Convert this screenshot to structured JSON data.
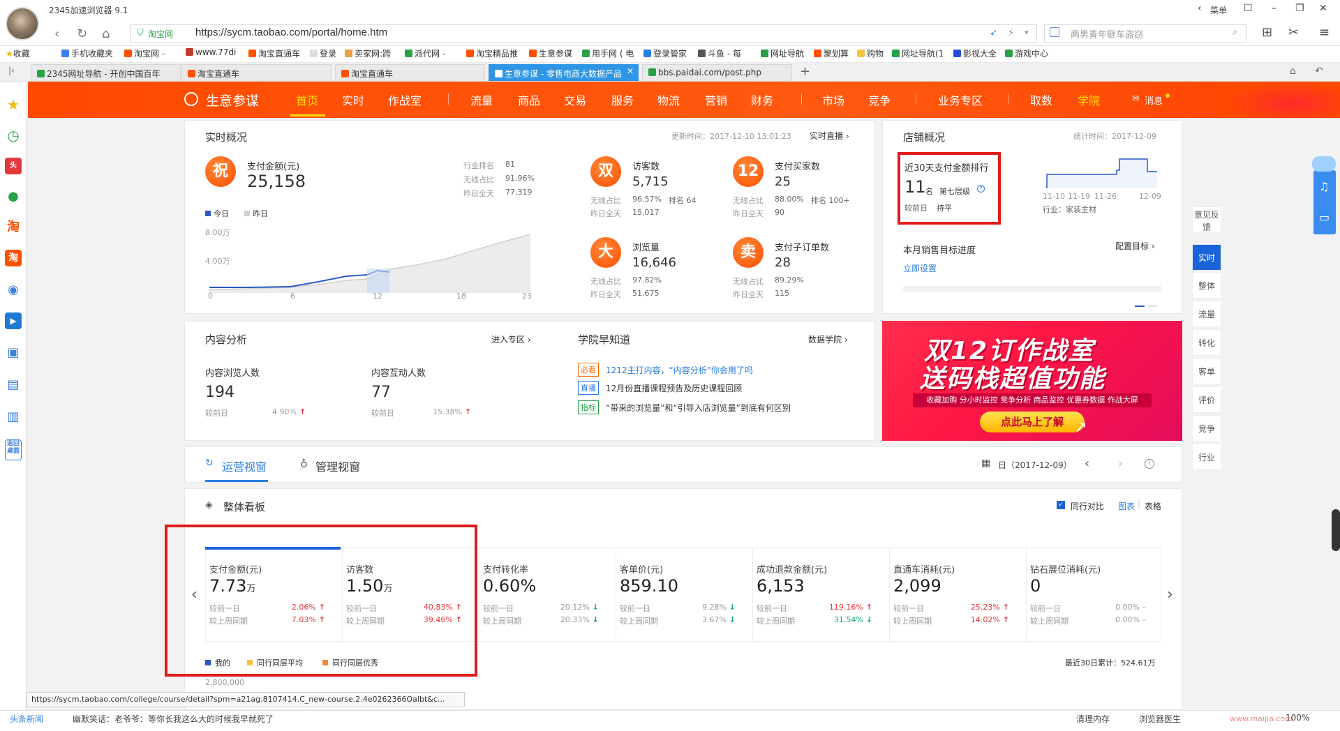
{
  "browser": {
    "app_title": "2345加速浏览器 9.1",
    "window_menu": "菜单",
    "addr_site": "淘宝网",
    "url": "https://sycm.taobao.com/portal/home.htm",
    "search_placeholder": "两男青年砸车盗窃",
    "bookmarks": [
      "收藏",
      "手机收藏夹",
      "淘宝网 -",
      "www.77di",
      "淘宝直通车",
      "登录",
      "卖家网:跨",
      "派代网 -",
      "淘宝精品推",
      "生意参谋",
      "用手网 ( 电",
      "登录管家",
      "斗鱼 - 每",
      "网址导航",
      "聚划算",
      "购物",
      "网址导航(1",
      "影视大全",
      "游戏中心"
    ],
    "tabs": [
      "2345网址导航 - 开创中国百年",
      "淘宝直通车",
      "淘宝直通车",
      "生意参谋 - 零售电商大数据产品",
      "bbs.paidai.com/post.php"
    ],
    "status_link": "https://sycm.taobao.com/college/course/detail?spm=a21ag.8107414.C_new-course.2.4e0262366Oalbt&c...",
    "status_news_label": "头条新闻",
    "status_news": "幽默笑话：老爷爷：等你长我这么大的时候我早就死了",
    "status_right": [
      "清理内存",
      "浏览器医生",
      "100%"
    ],
    "watermark": "www.maijia.com"
  },
  "nav": {
    "logo": "生意参谋",
    "items": [
      "首页",
      "实时",
      "作战室",
      "流量",
      "商品",
      "交易",
      "服务",
      "物流",
      "营销",
      "财务",
      "市场",
      "竞争",
      "业务专区",
      "取数",
      "学院",
      "消息"
    ]
  },
  "realtime": {
    "title": "实时概况",
    "update": "更新时间：2017-12-10 13:01:23",
    "live": "实时直播",
    "pay_label": "支付金额(元)",
    "pay_value": "25,158",
    "pay_icon": "祝",
    "rank_label": "行业排名",
    "rank_value": "81",
    "wireless_label": "无线占比",
    "wireless_value": "91.96%",
    "yday_label": "昨日全天",
    "yday_value": "77,319",
    "legend_today": "今日",
    "legend_yday": "昨日",
    "y_ticks": [
      "8.00万",
      "4.00万"
    ],
    "x_ticks": [
      "0",
      "6",
      "12",
      "18",
      "23"
    ],
    "metrics": [
      {
        "icon": "双",
        "label": "访客数",
        "value": "5,715",
        "r1l": "无线占比",
        "r1v": "96.57%",
        "r1x": "排名 64",
        "r2l": "昨日全天",
        "r2v": "15,017"
      },
      {
        "icon": "12",
        "label": "支付买家数",
        "value": "25",
        "r1l": "无线占比",
        "r1v": "88.00%",
        "r1x": "排名 100+",
        "r2l": "昨日全天",
        "r2v": "90"
      },
      {
        "icon": "大",
        "label": "浏览量",
        "value": "16,646",
        "r1l": "无线占比",
        "r1v": "97.82%",
        "r1x": "",
        "r2l": "昨日全天",
        "r2v": "51,675"
      },
      {
        "icon": "卖",
        "label": "支付子订单数",
        "value": "28",
        "r1l": "无线占比",
        "r1v": "89.29%",
        "r1x": "",
        "r2l": "昨日全天",
        "r2v": "115"
      }
    ]
  },
  "shop": {
    "title": "店铺概况",
    "stat_time": "统计时间：2017-12-09",
    "rank_title": "近30天支付金额排行",
    "rank_num": "11",
    "rank_unit": "名",
    "rank_level": "第七层级",
    "rank_cmp_label": "较前日",
    "rank_cmp_value": "持平",
    "x_ticks": [
      "11-10",
      "11-19",
      "11-26",
      "12-09"
    ],
    "industry": "行业：家装主材",
    "target_title": "本月销售目标进度",
    "target_config": "配置目标",
    "target_setup": "立即设置"
  },
  "content": {
    "title": "内容分析",
    "enter": "进入专区",
    "browse_label": "内容浏览人数",
    "browse_value": "194",
    "browse_cmp": "较前日",
    "browse_pct": "4.90%",
    "interact_label": "内容互动人数",
    "interact_value": "77",
    "interact_cmp": "较前日",
    "interact_pct": "15.38%"
  },
  "college": {
    "title": "学院早知道",
    "link": "数据学院",
    "items": [
      {
        "tag": "必看",
        "text": "1212主打内容，“内容分析”你会用了吗"
      },
      {
        "tag": "直播",
        "text": "12月份直播课程预告及历史课程回顾"
      },
      {
        "tag": "指标",
        "text": "“带来的浏览量”和“引导入店浏览量”到底有何区别"
      }
    ]
  },
  "banner": {
    "line1": "双12订作战室",
    "line2": "送码栈超值功能",
    "sub": "收藏加购 分小时监控 竞争分析 商品监控 优惠券数据 作战大屏",
    "cta": "点此马上了解"
  },
  "views": {
    "tab1": "运营视窗",
    "tab2": "管理视窗",
    "date": "日（2017-12-09）"
  },
  "board": {
    "title": "整体看板",
    "peer": "同行对比",
    "chart": "图表",
    "table": "表格",
    "cmp1": "较前一日",
    "cmp2": "较上周同期",
    "kpis": [
      {
        "label": "支付金额(元)",
        "value": "7.73",
        "unit": "万",
        "d1": "2.06%",
        "d1dir": "up",
        "d2": "7.03%",
        "d2dir": "up"
      },
      {
        "label": "访客数",
        "value": "1.50",
        "unit": "万",
        "d1": "40.83%",
        "d1dir": "up",
        "d2": "39.46%",
        "d2dir": "up"
      },
      {
        "label": "支付转化率",
        "value": "0.60%",
        "unit": "",
        "d1": "20.12%",
        "d1dir": "down",
        "d2": "20.33%",
        "d2dir": "down"
      },
      {
        "label": "客单价(元)",
        "value": "859.10",
        "unit": "",
        "d1": "9.28%",
        "d1dir": "down",
        "d2": "3.67%",
        "d2dir": "down"
      },
      {
        "label": "成功退款金额(元)",
        "value": "6,153",
        "unit": "",
        "d1": "119.16%",
        "d1dir": "up",
        "d2": "31.54%",
        "d2dir": "down"
      },
      {
        "label": "直通车消耗(元)",
        "value": "2,099",
        "unit": "",
        "d1": "25.23%",
        "d1dir": "up",
        "d2": "14.02%",
        "d2dir": "up"
      },
      {
        "label": "钻石展位消耗(元)",
        "value": "0",
        "unit": "",
        "d1": "0.00%",
        "d1dir": "flat",
        "d2": "0.00%",
        "d2dir": "flat"
      }
    ],
    "legend": [
      "我的",
      "同行同层平均",
      "同行同层优秀"
    ],
    "total": "最近30日累计：524.61万",
    "y_top": "2,800,000"
  },
  "rail": [
    "意见反馈",
    "实时",
    "整体",
    "流量",
    "转化",
    "客单",
    "评价",
    "竞争",
    "行业"
  ],
  "colors": {
    "brand": "#ff4a00",
    "accent": "#1a63d8",
    "up": "#e4393c",
    "down": "#13a86f",
    "highlight": "#e01b1b"
  }
}
